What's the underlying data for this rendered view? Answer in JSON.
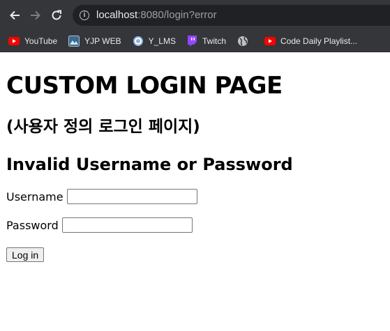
{
  "browser": {
    "url_host": "localhost",
    "url_rest": ":8080/login?error",
    "bookmarks": [
      {
        "label": "YouTube",
        "icon": "youtube-icon"
      },
      {
        "label": "YJP WEB",
        "icon": "yjp-icon"
      },
      {
        "label": "Y_LMS",
        "icon": "lms-icon"
      },
      {
        "label": "Twitch",
        "icon": "twitch-icon"
      },
      {
        "label": "",
        "icon": "globe-icon"
      },
      {
        "label": "Code Daily Playlist...",
        "icon": "youtube-icon"
      }
    ]
  },
  "page": {
    "title": "CUSTOM LOGIN PAGE",
    "subtitle": "(사용자 정의 로그인 페이지)",
    "error": "Invalid Username or Password",
    "username_label": "Username",
    "username_value": "",
    "password_label": "Password",
    "password_value": "",
    "submit_label": "Log in"
  },
  "colors": {
    "chrome_bg": "#35363a",
    "omnibox_bg": "#202124",
    "youtube_red": "#ff0000",
    "twitch_purple": "#9146ff"
  }
}
